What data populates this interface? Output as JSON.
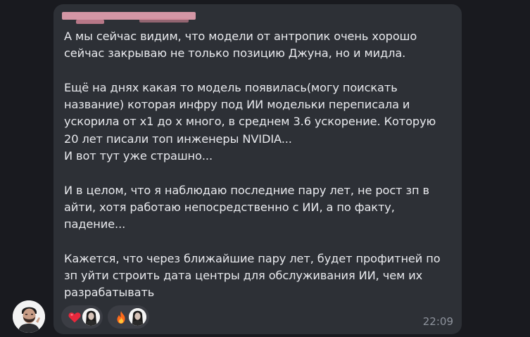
{
  "message": {
    "paragraphs": [
      "А мы сейчас видим, что модели от антропик очень хорошо\nсейчас закрываю не только позицию Джуна, но и мидла.",
      "Ещё на днях какая то модель появилась(могу поискать\nназвание) которая инфру под ИИ модельки переписала и\nускорила от х1 до х много, в среднем 3.6 ускорение. Которую\n20 лет писали топ инженеры NVIDIA...\nИ вот тут уже страшно...",
      "И в целом, что я наблюдаю последние пару лет, не рост зп в\nайти, хотя работаю непосредственно с ИИ, а по факту,\nпадение...",
      "Кажется, что через ближайшие пару лет, будет профитней по\nзп уйти строить дата центры для обслуживания ИИ, чем их\nразрабатывать"
    ],
    "time": "22:09"
  },
  "reactions": [
    {
      "emoji": "heart-icon",
      "color": "#e8283c"
    },
    {
      "emoji": "fire-icon",
      "color": "#ff8a1f"
    }
  ],
  "colors": {
    "background": "#191a1f",
    "bubble": "#2d3036",
    "text": "#e9eaee",
    "muted": "#8e939d",
    "reaction_bg": "#3b3d44",
    "sender_redacted": "#e7a2b1"
  }
}
